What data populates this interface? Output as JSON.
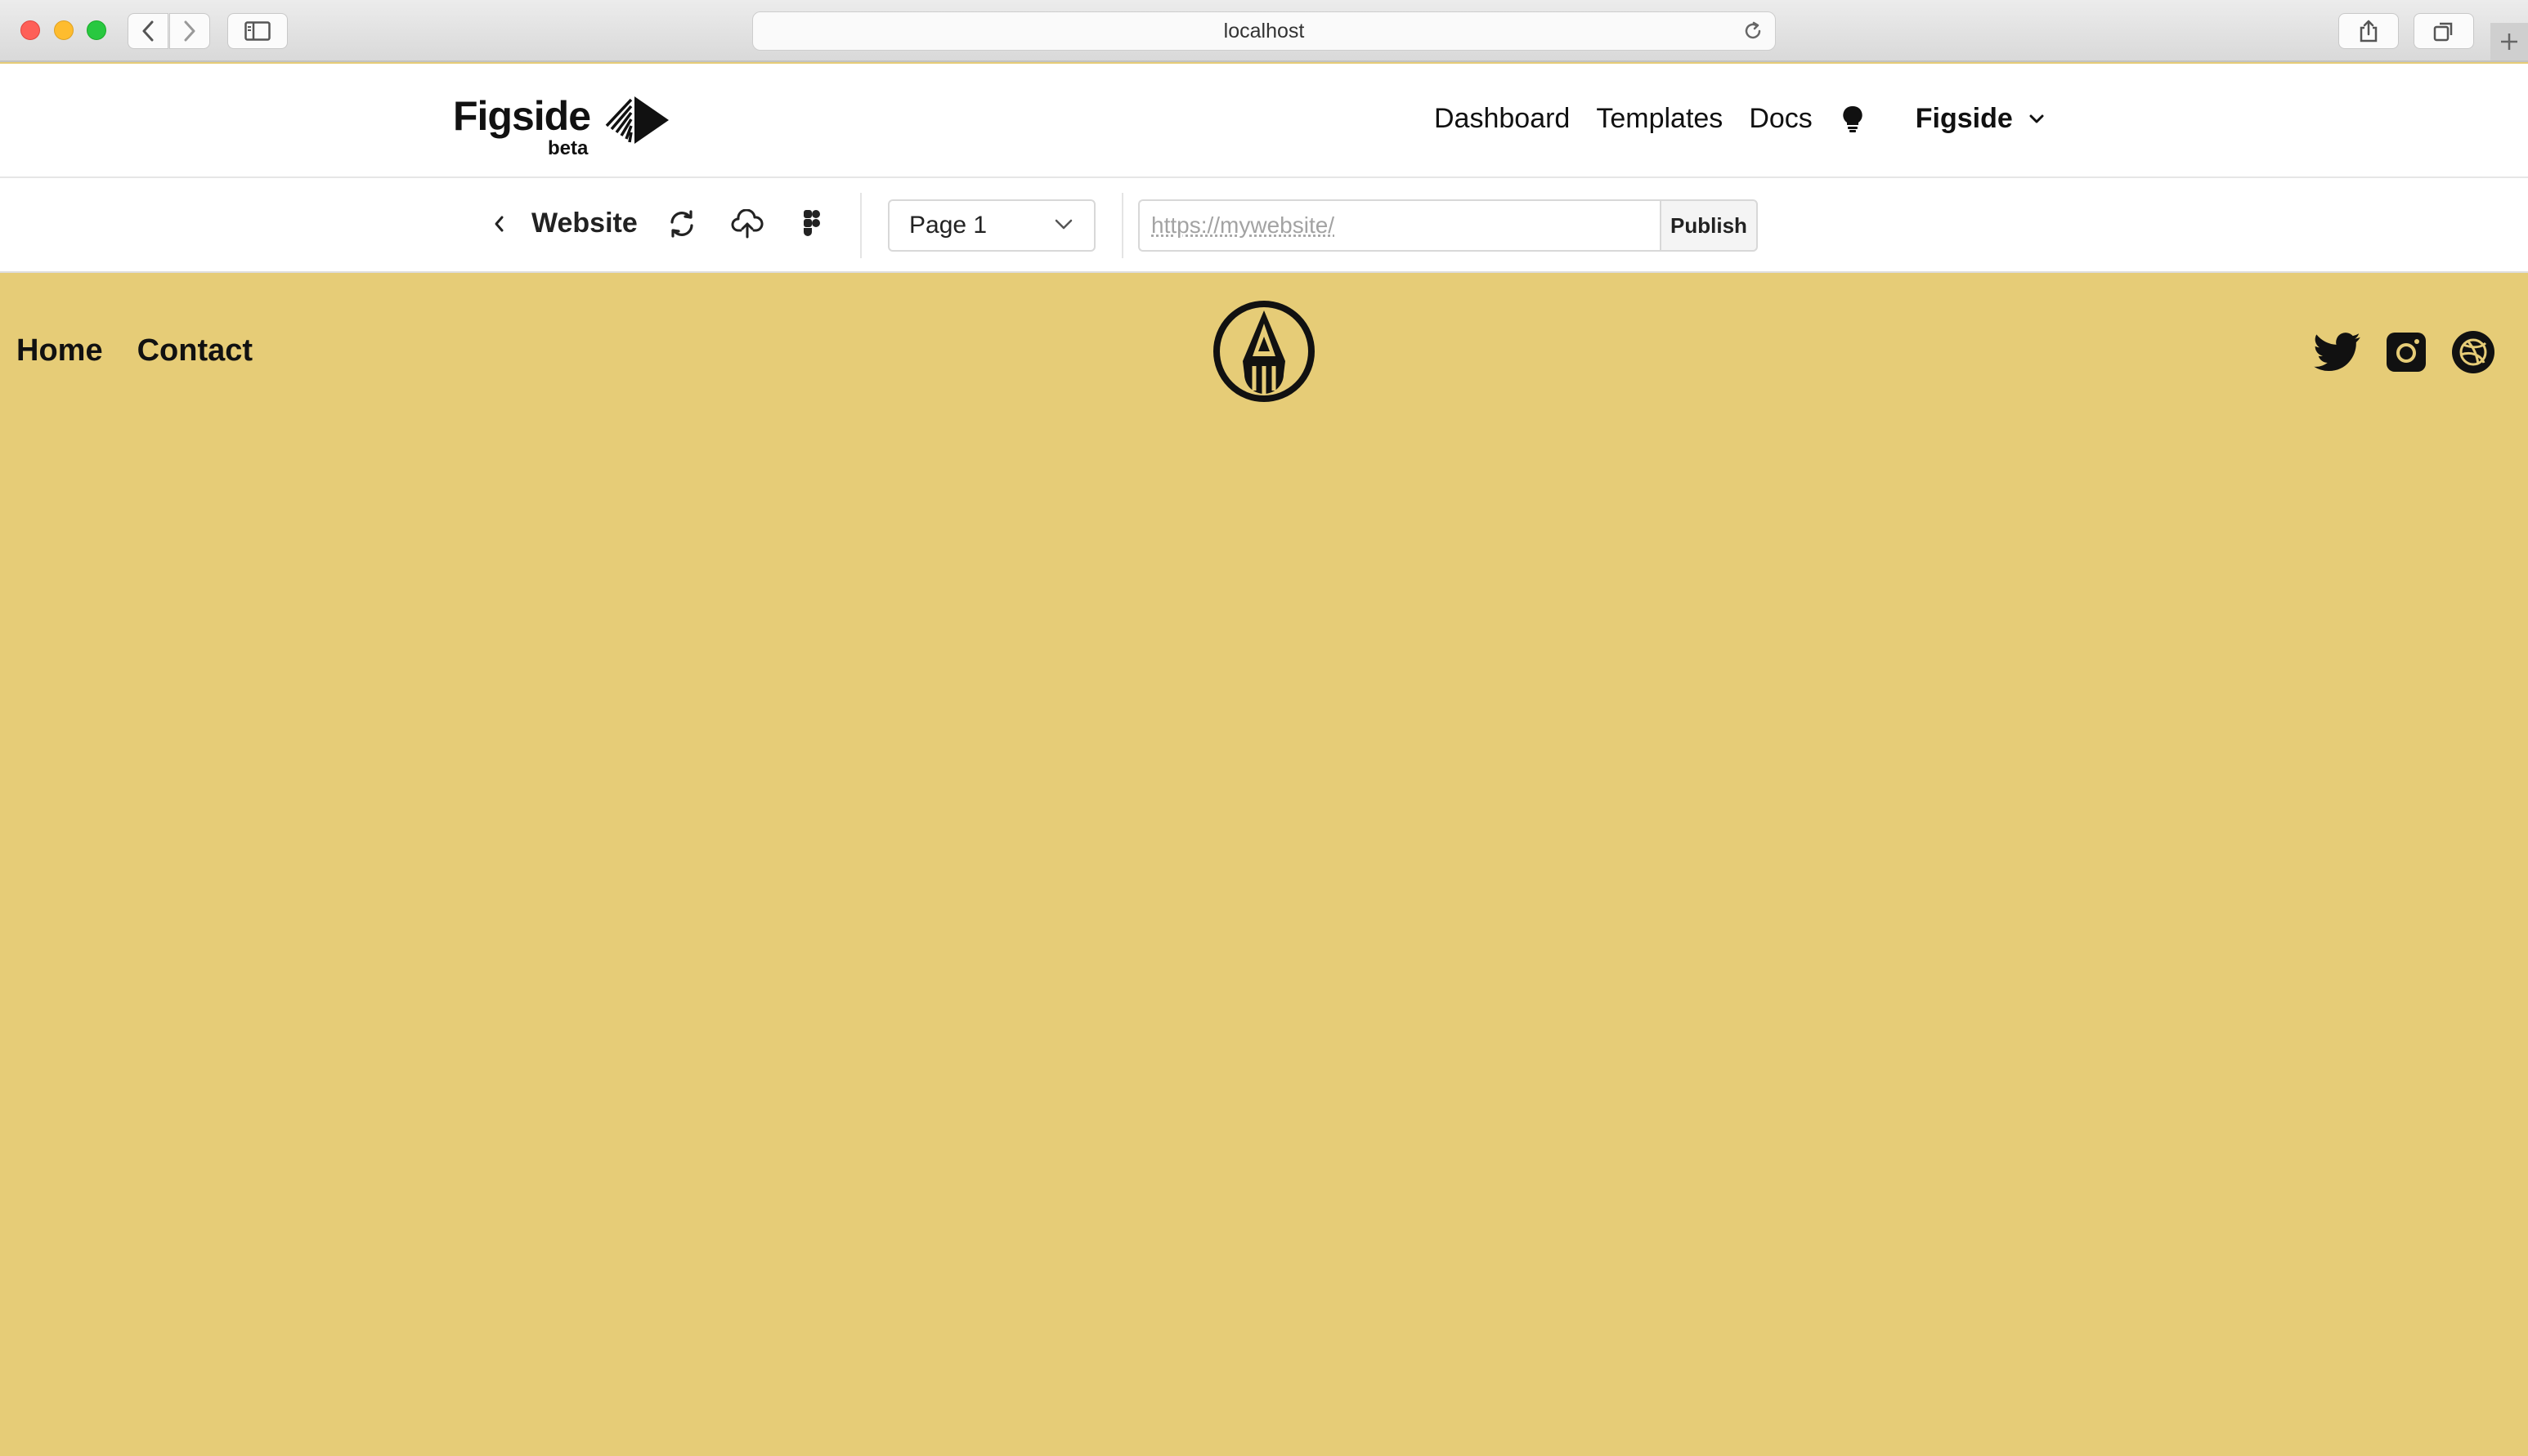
{
  "browser": {
    "url": "localhost",
    "icons": [
      "back-icon",
      "forward-icon",
      "sidebar-icon",
      "reload-icon",
      "share-icon",
      "tabs-icon",
      "plus-icon"
    ]
  },
  "header": {
    "brand_name": "Figside",
    "brand_badge": "beta",
    "nav": [
      "Dashboard",
      "Templates",
      "Docs"
    ],
    "account_name": "Figside"
  },
  "toolbar": {
    "site_title": "Website",
    "page_select": "Page 1",
    "url_placeholder": "https://mywebsite/",
    "publish_label": "Publish"
  },
  "site": {
    "background": "#e6cc77",
    "nav": [
      "Home",
      "Contact"
    ],
    "social_icons": [
      "twitter-icon",
      "instagram-icon",
      "dribbble-icon"
    ]
  }
}
